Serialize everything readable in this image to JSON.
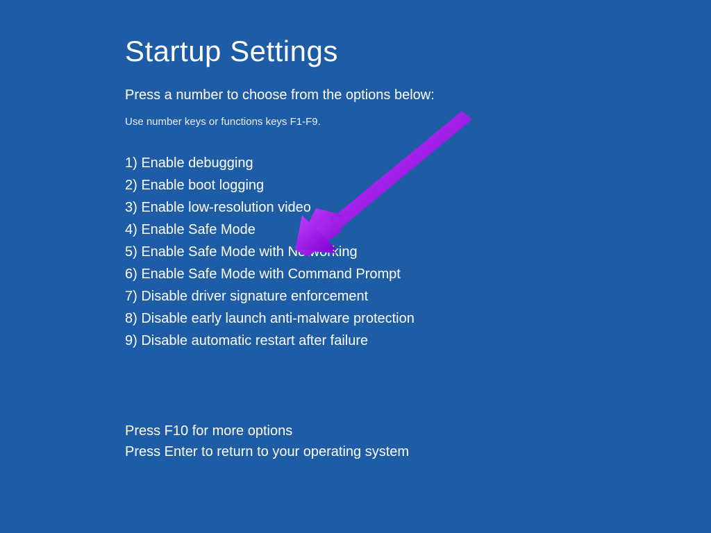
{
  "title": "Startup Settings",
  "subtitle": "Press a number to choose from the options below:",
  "hint": "Use number keys or functions keys F1-F9.",
  "options": [
    "1) Enable debugging",
    "2) Enable boot logging",
    "3) Enable low-resolution video",
    "4) Enable Safe Mode",
    "5) Enable Safe Mode with Networking",
    "6) Enable Safe Mode with Command Prompt",
    "7) Disable driver signature enforcement",
    "8) Disable early launch anti-malware protection",
    "9) Disable automatic restart after failure"
  ],
  "footer": {
    "more_options": "Press F10 for more options",
    "return": "Press Enter to return to your operating system"
  },
  "annotation": {
    "arrow_color": "#a020f0"
  }
}
